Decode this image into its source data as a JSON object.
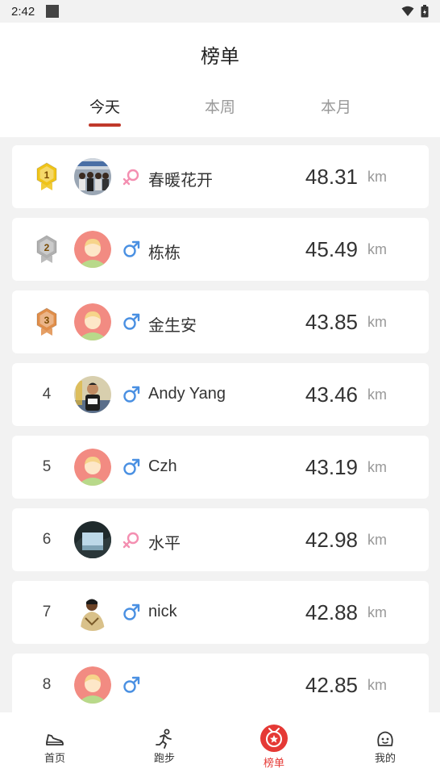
{
  "status_bar": {
    "time": "2:42"
  },
  "header": {
    "title": "榜单",
    "tabs": [
      {
        "label": "今天",
        "active": true
      },
      {
        "label": "本周",
        "active": false
      },
      {
        "label": "本月",
        "active": false
      }
    ]
  },
  "colors": {
    "accent": "#c0392b",
    "female": "#f48fb1",
    "male": "#4a90e2",
    "gold": "#f0c419",
    "silver": "#b0b0b0",
    "bronze": "#e08e4a"
  },
  "leaderboard": {
    "unit": "km",
    "rows": [
      {
        "rank": "1",
        "medal": "gold",
        "avatar": "photo-group",
        "gender": "female",
        "name": "春暖花开",
        "distance": "48.31"
      },
      {
        "rank": "2",
        "medal": "silver",
        "avatar": "default",
        "gender": "male",
        "name": "栋栋",
        "distance": "45.49"
      },
      {
        "rank": "3",
        "medal": "bronze",
        "avatar": "default",
        "gender": "male",
        "name": "金生安",
        "distance": "43.85"
      },
      {
        "rank": "4",
        "medal": "",
        "avatar": "photo-runner",
        "gender": "male",
        "name": "Andy Yang",
        "distance": "43.46"
      },
      {
        "rank": "5",
        "medal": "",
        "avatar": "default",
        "gender": "male",
        "name": "Czh",
        "distance": "43.19"
      },
      {
        "rank": "6",
        "medal": "",
        "avatar": "photo-scenery",
        "gender": "female",
        "name": "水平",
        "distance": "42.98"
      },
      {
        "rank": "7",
        "medal": "",
        "avatar": "photo-person",
        "gender": "male",
        "name": "nick",
        "distance": "42.88"
      },
      {
        "rank": "8",
        "medal": "",
        "avatar": "default",
        "gender": "male",
        "name": "",
        "distance": "42.85"
      }
    ]
  },
  "bottom_nav": {
    "items": [
      {
        "label": "首页",
        "icon": "shoe-icon"
      },
      {
        "label": "跑步",
        "icon": "runner-icon"
      },
      {
        "label": "榜单",
        "icon": "medal-icon",
        "active": true
      },
      {
        "label": "我的",
        "icon": "face-icon"
      }
    ]
  }
}
